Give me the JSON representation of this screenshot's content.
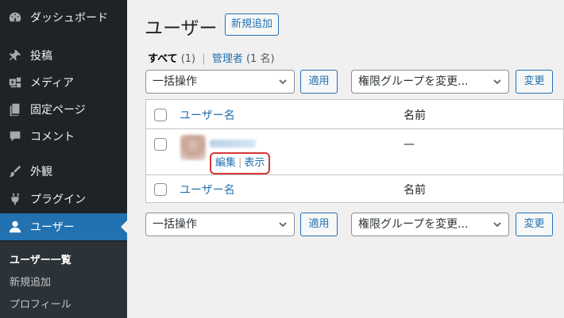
{
  "sidebar": {
    "items": [
      {
        "label": "ダッシュボード",
        "icon": "dashboard-icon"
      },
      {
        "label": "投稿",
        "icon": "pin-icon"
      },
      {
        "label": "メディア",
        "icon": "media-icon"
      },
      {
        "label": "固定ページ",
        "icon": "page-icon"
      },
      {
        "label": "コメント",
        "icon": "comment-icon"
      },
      {
        "label": "外観",
        "icon": "paintbrush-icon"
      },
      {
        "label": "プラグイン",
        "icon": "plugin-icon"
      },
      {
        "label": "ユーザー",
        "icon": "user-icon",
        "active": true
      }
    ],
    "submenu": [
      {
        "label": "ユーザー一覧",
        "current": true
      },
      {
        "label": "新規追加"
      },
      {
        "label": "プロフィール"
      }
    ]
  },
  "header": {
    "title": "ユーザー",
    "add_new_label": "新規追加"
  },
  "filters": {
    "all_label": "すべて",
    "all_count": "(1)",
    "separator": "|",
    "admin_label": "管理者",
    "admin_count": "(1 名)"
  },
  "top_nav": {
    "bulk_action": "一括操作",
    "apply_label": "適用",
    "role_select": "権限グループを変更...",
    "change_label": "変更"
  },
  "bottom_nav": {
    "bulk_action": "一括操作",
    "apply_label": "適用",
    "role_select": "権限グループを変更...",
    "change_label": "変更"
  },
  "table": {
    "headers": {
      "username": "ユーザー名",
      "name": "名前"
    },
    "footers": {
      "username": "ユーザー名",
      "name": "名前"
    },
    "rows": [
      {
        "name": "—",
        "actions": {
          "edit": "編集",
          "sep": "|",
          "view": "表示"
        }
      }
    ]
  },
  "colors": {
    "accent": "#2271b1",
    "sidebar_bg": "#1d2327",
    "highlight": "#d63638"
  }
}
